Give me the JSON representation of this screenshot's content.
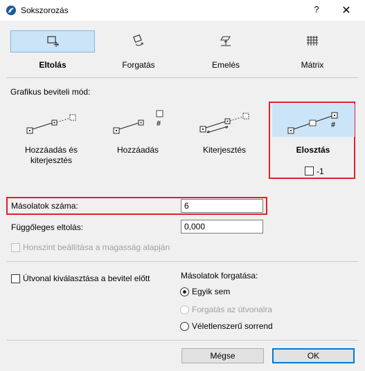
{
  "window": {
    "title": "Sokszorozás",
    "help_glyph": "?",
    "close_glyph": "✕"
  },
  "tabs": [
    {
      "label": "Eltolás",
      "icon": "move-icon",
      "active": true
    },
    {
      "label": "Forgatás",
      "icon": "rotate-icon",
      "active": false
    },
    {
      "label": "Emelés",
      "icon": "elevate-icon",
      "active": false
    },
    {
      "label": "Mátrix",
      "icon": "matrix-icon",
      "active": false
    }
  ],
  "input_mode": {
    "label": "Grafikus beviteli mód:",
    "modes": [
      {
        "label": "Hozzáadás és kiterjesztés",
        "icon": "add-extend-icon"
      },
      {
        "label": "Hozzáadás",
        "icon": "add-icon"
      },
      {
        "label": "Kiterjesztés",
        "icon": "extend-icon"
      },
      {
        "label": "Elosztás",
        "icon": "distribute-icon",
        "selected": true
      }
    ],
    "distribute_option_label": "-1",
    "hash_glyph": "#"
  },
  "fields": {
    "copies_label": "Másolatok száma:",
    "copies_value": "6",
    "vertical_offset_label": "Függőleges eltolás:",
    "vertical_offset_value": "0,000",
    "story_by_elevation_label": "Honszint beállítása a magasság alapján"
  },
  "path": {
    "select_path_label": "Útvonal kiválasztása a bevitel előtt"
  },
  "rotation": {
    "label": "Másolatok forgatása:",
    "options": [
      {
        "label": "Egyik sem",
        "checked": true,
        "enabled": true
      },
      {
        "label": "Forgatás az útvonalra",
        "checked": false,
        "enabled": false
      },
      {
        "label": "Véletlenszerű sorrend",
        "checked": false,
        "enabled": true
      }
    ]
  },
  "buttons": {
    "cancel": "Mégse",
    "ok": "OK"
  },
  "colors": {
    "selected_bg": "#cce4f7",
    "highlight_red": "#e0202a",
    "default_button_border": "#0078d7"
  }
}
